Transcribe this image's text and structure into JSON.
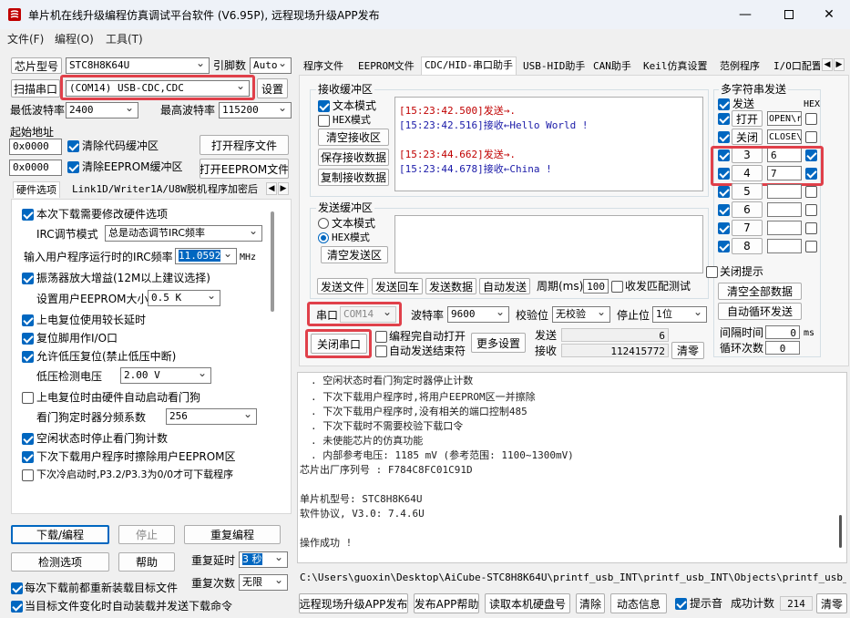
{
  "app": {
    "title": "单片机在线升级编程仿真调试平台软件 (V6.95P), 远程现场升级APP发布",
    "menu": [
      "文件(F)",
      "编程(O)",
      "工具(T)"
    ]
  },
  "left": {
    "chip_label": "芯片型号",
    "chip_value": "STC8H8K64U",
    "pin_label": "引脚数",
    "pin_value": "Auto",
    "scan_button": "扫描串口",
    "port_value": "(COM14) USB-CDC,CDC",
    "settings_button": "设置",
    "min_baud_label": "最低波特率",
    "min_baud_value": "2400",
    "max_baud_label": "最高波特率",
    "max_baud_value": "115200",
    "start_addr_label": "起始地址",
    "addr1_value": "0x0000",
    "clear_code_label": "清除代码缓冲区",
    "open_program_button": "打开程序文件",
    "addr2_value": "0x0000",
    "clear_eeprom_label": "清除EEPROM缓冲区",
    "open_eeprom_button": "打开EEPROM文件",
    "tabs": [
      "硬件选项",
      "Link1D/Writer1A/U8W脱机",
      "程序加密后"
    ],
    "options": {
      "opt1": "本次下载需要修改硬件选项",
      "irc_mode_label": "IRC调节模式",
      "irc_mode_value": "总是动态调节IRC频率",
      "irc_freq_label": "输入用户程序运行时的IRC频率",
      "irc_freq_value": "11.0592",
      "irc_unit": "MHz",
      "opt2": "振荡器放大增益(12M以上建议选择)",
      "eeprom_size_label": "设置用户EEPROM大小",
      "eeprom_size_value": "0.5 K",
      "opt3": "上电复位使用较长延时",
      "opt4": "复位脚用作I/O口",
      "opt5": "允许低压复位(禁止低压中断)",
      "lvd_label": "低压检测电压",
      "lvd_value": "2.00 V",
      "opt6": "上电复位时由硬件自动启动看门狗",
      "wdt_label": "看门狗定时器分频系数",
      "wdt_value": "256",
      "opt7": "空闲状态时停止看门狗计数",
      "opt8": "下次下载用户程序时擦除用户EEPROM区",
      "opt9": "下次冷启动时,P3.2/P3.3为0/0才可下载程序"
    },
    "download_button": "下载/编程",
    "stop_button": "停止",
    "reprogram_button": "重复编程",
    "check_button": "检测选项",
    "help_button": "帮助",
    "repeat_delay_label": "重复延时",
    "repeat_delay_value": "3 秒",
    "repeat_count_label": "重复次数",
    "repeat_count_value": "无限",
    "reload_label": "每次下载前都重新装载目标文件",
    "autosend_label": "当目标文件变化时自动装载并发送下载命令"
  },
  "right": {
    "tabs": [
      "程序文件",
      "EEPROM文件",
      "CDC/HID-串口助手",
      "USB-HID助手",
      "CAN助手",
      "Keil仿真设置",
      "范例程序",
      "I/O口配置"
    ],
    "rx": {
      "group_label": "接收缓冲区",
      "text_mode": "文本模式",
      "hex_mode": "HEX模式",
      "clear_button": "清空接收区",
      "save_button": "保存接收数据",
      "copy_button": "复制接收数据",
      "lines": [
        {
          "time": "[15:23:42.500]",
          "dir": "发送→",
          "msg": ".",
          "color": "#c00000"
        },
        {
          "time": "[15:23:42.516]",
          "dir": "接收←",
          "msg": "Hello World !",
          "color": "#1a1aa8"
        },
        {
          "time": "[15:23:44.662]",
          "dir": "发送→",
          "msg": ".",
          "color": "#c00000"
        },
        {
          "time": "[15:23:44.678]",
          "dir": "接收←",
          "msg": "China !",
          "color": "#1a1aa8"
        }
      ]
    },
    "tx": {
      "group_label": "发送缓冲区",
      "text_mode": "文本模式",
      "hex_mode": "HEX模式",
      "clear_button": "清空发送区",
      "send_file": "发送文件",
      "send_enter": "发送回车",
      "send_data": "发送数据",
      "auto_send": "自动发送",
      "period_label": "周期(ms)",
      "period_value": "100",
      "match_label": "收发匹配测试"
    },
    "serial": {
      "port_label": "串口",
      "port_value": "COM14",
      "baud_label": "波特率",
      "baud_value": "9600",
      "parity_label": "校验位",
      "parity_value": "无校验",
      "stop_label": "停止位",
      "stop_value": "1位",
      "close_button": "关闭串口",
      "auto_open": "编程完自动打开",
      "auto_end": "自动发送结束符",
      "more_button": "更多设置",
      "send_label": "发送",
      "send_count": "6",
      "recv_label": "接收",
      "recv_count": "112415772",
      "clear_button": "清零"
    },
    "multi": {
      "title": "多字符串发送",
      "send_label": "发送",
      "hex_label": "HEX",
      "open_button": "打开",
      "close_button": "关闭",
      "open_value": "OPEN\\r",
      "close_value": "CLOSE\\",
      "rows": [
        {
          "num": "3",
          "value": "6",
          "hex": true
        },
        {
          "num": "4",
          "value": "7",
          "hex": true
        },
        {
          "num": "5",
          "value": "",
          "hex": false
        },
        {
          "num": "6",
          "value": "",
          "hex": false
        },
        {
          "num": "7",
          "value": "",
          "hex": false
        },
        {
          "num": "8",
          "value": "",
          "hex": false
        }
      ],
      "close_hint": "关闭提示",
      "clear_all": "清空全部数据",
      "auto_loop": "自动循环发送",
      "interval_label": "间隔时间",
      "interval_value": "0",
      "interval_unit": "ms",
      "loop_label": "循环次数",
      "loop_value": "0"
    },
    "log": {
      "lines": [
        ". 空闲状态时看门狗定时器停止计数",
        ". 下次下载用户程序时,将用户EEPROM区一并擦除",
        ". 下次下载用户程序时,没有相关的端口控制485",
        ". 下次下载时不需要校验下载口令",
        ". 未使能芯片的仿真功能",
        ". 内部参考电压: 1185 mV (参考范围: 1100~1300mV)",
        "芯片出厂序列号 : F784C8FC01C91D",
        "",
        "  单片机型号: STC8H8K64U",
        "  软件协议, V3.0: 7.4.6U",
        "",
        "操作成功 !"
      ]
    },
    "path": "C:\\Users\\guoxin\\Desktop\\AiCube-STC8H8K64U\\printf_usb_INT\\printf_usb_INT\\Objects\\printf_usb_INT.hex",
    "bottom": {
      "publish": "远程现场升级APP发布",
      "publish_help": "发布APP帮助",
      "read_disk": "读取本机硬盘号",
      "clear": "清除",
      "news": "动态信息",
      "beep_label": "提示音",
      "success_label": "成功计数",
      "success_value": "214",
      "zero": "清零"
    }
  },
  "colors": {
    "accent": "#0067c0",
    "highlight": "#e0404a",
    "tx_red": "#c00000",
    "rx_blue": "#1a1aa8"
  }
}
